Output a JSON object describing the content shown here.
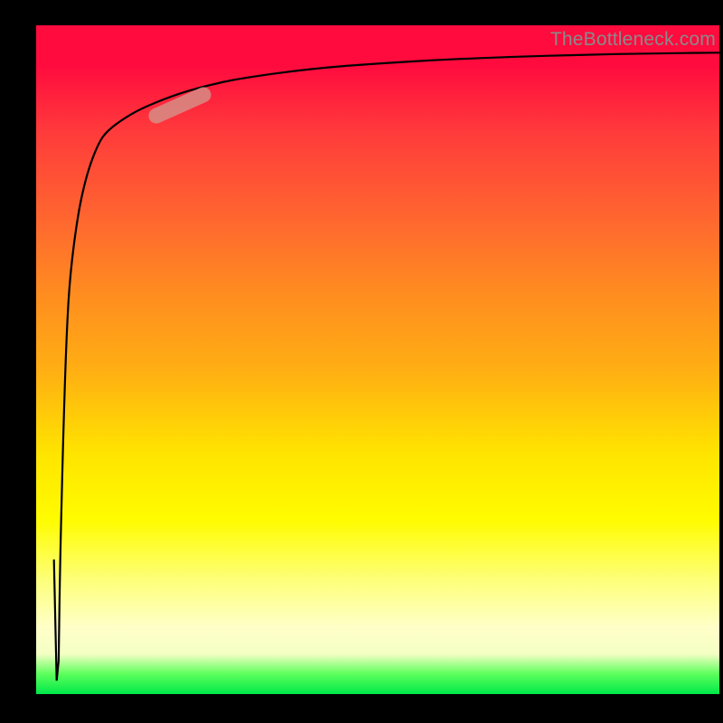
{
  "watermark": "TheBottleneck.com",
  "chart_data": {
    "type": "line",
    "title": "",
    "xlabel": "",
    "ylabel": "",
    "xlim": [
      0,
      100
    ],
    "ylim": [
      0,
      100
    ],
    "gradient_stops": [
      {
        "pos": 0,
        "color": "#ff0b3e"
      },
      {
        "pos": 16,
        "color": "#ff3b3b"
      },
      {
        "pos": 40,
        "color": "#ff8c20"
      },
      {
        "pos": 64,
        "color": "#ffe400"
      },
      {
        "pos": 90,
        "color": "#ffffc8"
      },
      {
        "pos": 100,
        "color": "#00e84a"
      }
    ],
    "series": [
      {
        "name": "curve",
        "x": [
          3.0,
          3.3,
          3.5,
          4.0,
          4.5,
          5.0,
          6.0,
          7.0,
          8.0,
          9.0,
          10.0,
          12.0,
          15.0,
          20.0,
          25.0,
          30.0,
          40.0,
          50.0,
          60.0,
          70.0,
          80.0,
          90.0,
          100.0
        ],
        "y": [
          2.0,
          5.0,
          20.0,
          40.0,
          55.0,
          63.0,
          71.0,
          76.0,
          79.5,
          82.0,
          83.8,
          85.5,
          87.4,
          89.5,
          91.0,
          92.1,
          93.5,
          94.3,
          94.9,
          95.3,
          95.6,
          95.8,
          95.9
        ]
      }
    ],
    "highlight_segment": {
      "x_range": [
        16,
        26
      ],
      "y_range": [
        86.5,
        89.8
      ],
      "angle_deg": -24
    }
  }
}
